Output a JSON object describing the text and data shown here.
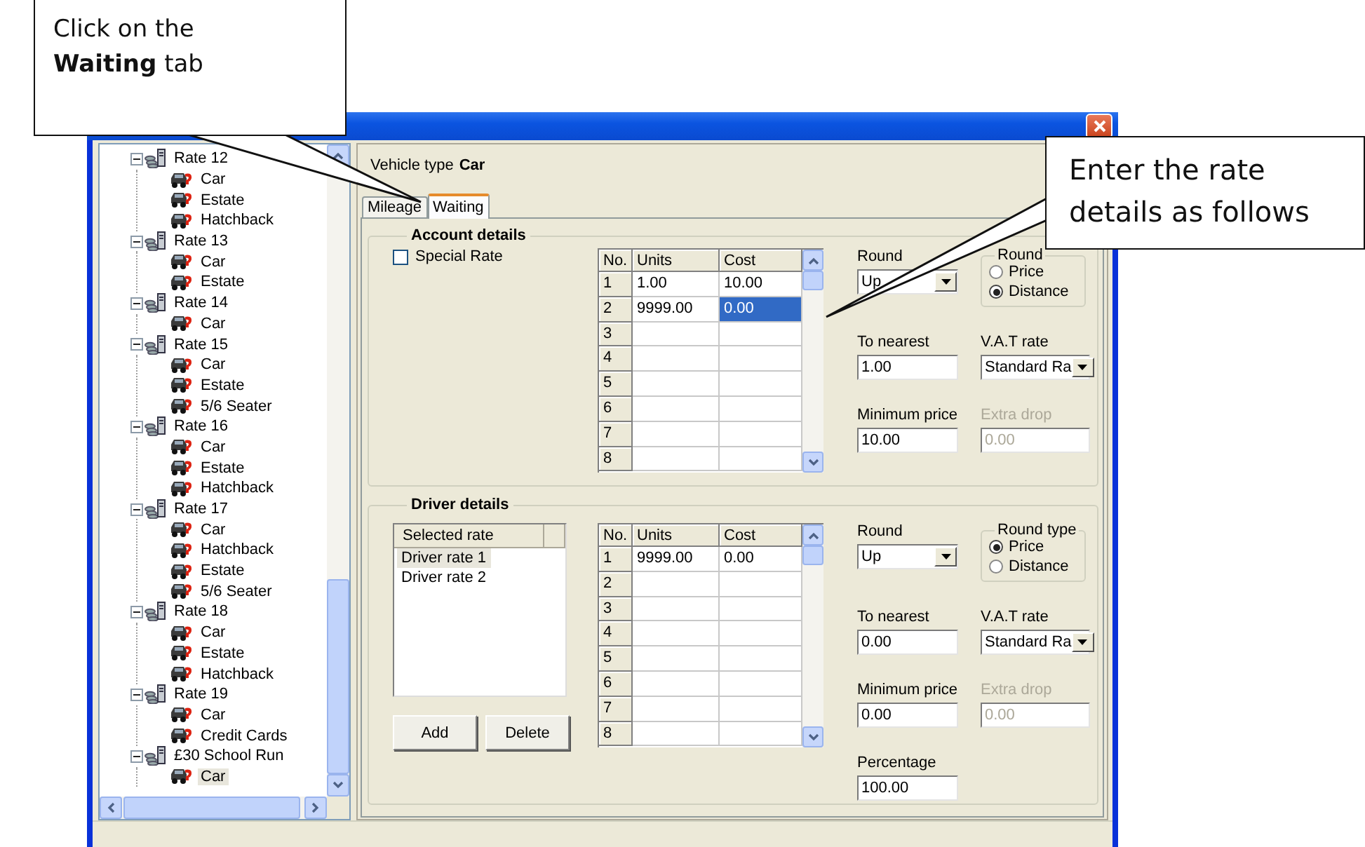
{
  "callouts": [
    {
      "text": "Click on the **Waiting** tab"
    },
    {
      "text": "Enter the rate details as follows"
    }
  ],
  "tree": {
    "items": [
      {
        "label": "Rate 12",
        "expanded": true,
        "selected": false,
        "children": [
          {
            "label": "Car",
            "selected": false
          },
          {
            "label": "Estate",
            "selected": false
          },
          {
            "label": "Hatchback",
            "selected": false
          }
        ]
      },
      {
        "label": "Rate 13",
        "expanded": true,
        "selected": false,
        "children": [
          {
            "label": "Car",
            "selected": false
          },
          {
            "label": "Estate",
            "selected": false
          }
        ]
      },
      {
        "label": "Rate 14",
        "expanded": true,
        "selected": false,
        "children": [
          {
            "label": "Car",
            "selected": false
          }
        ]
      },
      {
        "label": "Rate 15",
        "expanded": true,
        "selected": false,
        "children": [
          {
            "label": "Car",
            "selected": false
          },
          {
            "label": "Estate",
            "selected": false
          },
          {
            "label": "5/6 Seater",
            "selected": false
          }
        ]
      },
      {
        "label": "Rate 16",
        "expanded": true,
        "selected": false,
        "children": [
          {
            "label": "Car",
            "selected": false
          },
          {
            "label": "Estate",
            "selected": false
          },
          {
            "label": "Hatchback",
            "selected": false
          }
        ]
      },
      {
        "label": "Rate 17",
        "expanded": true,
        "selected": false,
        "children": [
          {
            "label": "Car",
            "selected": false
          },
          {
            "label": "Hatchback",
            "selected": false
          },
          {
            "label": "Estate",
            "selected": false
          },
          {
            "label": "5/6 Seater",
            "selected": false
          }
        ]
      },
      {
        "label": "Rate 18",
        "expanded": true,
        "selected": false,
        "children": [
          {
            "label": "Car",
            "selected": false
          },
          {
            "label": "Estate",
            "selected": false
          },
          {
            "label": "Hatchback",
            "selected": false
          }
        ]
      },
      {
        "label": "Rate 19",
        "expanded": true,
        "selected": false,
        "children": [
          {
            "label": "Car",
            "selected": false
          },
          {
            "label": "Credit Cards",
            "selected": false
          }
        ]
      },
      {
        "label": "£30 School Run",
        "expanded": true,
        "selected": false,
        "children": [
          {
            "label": "Car",
            "selected": true
          }
        ]
      }
    ]
  },
  "vehicle_type": {
    "label": "Vehicle type",
    "value": "Car"
  },
  "tabs": [
    {
      "label": "Mileage",
      "selected": false
    },
    {
      "label": "Waiting",
      "selected": true
    }
  ],
  "account_details": {
    "title": "Account details",
    "special_rate": {
      "label": "Special Rate",
      "checked": false
    },
    "grid": {
      "columns": [
        "No.",
        "Units",
        "Cost"
      ],
      "rows": [
        {
          "no": "1",
          "cells": [
            {
              "text": "1.00",
              "selected": false
            },
            {
              "text": "10.00",
              "selected": false
            }
          ]
        },
        {
          "no": "2",
          "cells": [
            {
              "text": "9999.00",
              "selected": false
            },
            {
              "text": "0.00",
              "selected": true
            }
          ]
        },
        {
          "no": "3"
        },
        {
          "no": "4"
        },
        {
          "no": "5"
        },
        {
          "no": "6"
        },
        {
          "no": "7"
        },
        {
          "no": "8"
        }
      ]
    },
    "fields": [
      {
        "kind": "dropdown",
        "label": "Round",
        "value": "Up"
      },
      {
        "kind": "radio_group",
        "legend": "Round",
        "options": [
          {
            "label": "Price",
            "selected": false
          },
          {
            "label": "Distance",
            "selected": true
          }
        ]
      },
      {
        "kind": "text",
        "label": "To nearest",
        "value": "1.00",
        "disabled": false
      },
      {
        "kind": "dropdown",
        "label": "V.A.T rate",
        "value": "Standard Ra"
      },
      {
        "kind": "text",
        "label": "Minimum price",
        "value": "10.00",
        "disabled": false
      },
      {
        "kind": "text",
        "label": "Extra drop",
        "value": "0.00",
        "disabled": true
      }
    ]
  },
  "driver_details": {
    "title": "Driver details",
    "selected_rate": {
      "columns": [
        "Selected rate"
      ],
      "items": [
        {
          "label": "Driver rate 1",
          "selected": true
        },
        {
          "label": "Driver rate 2",
          "selected": false
        }
      ]
    },
    "buttons": [
      "Add",
      "Delete"
    ],
    "grid": {
      "columns": [
        "No.",
        "Units",
        "Cost"
      ],
      "rows": [
        {
          "no": "1",
          "cells": [
            {
              "text": "9999.00",
              "selected": false
            },
            {
              "text": "0.00",
              "selected": false
            }
          ]
        },
        {
          "no": "2"
        },
        {
          "no": "3"
        },
        {
          "no": "4"
        },
        {
          "no": "5"
        },
        {
          "no": "6"
        },
        {
          "no": "7"
        },
        {
          "no": "8"
        }
      ]
    },
    "fields": [
      {
        "kind": "dropdown",
        "label": "Round",
        "value": "Up"
      },
      {
        "kind": "radio_group",
        "legend": "Round type",
        "options": [
          {
            "label": "Price",
            "selected": true
          },
          {
            "label": "Distance",
            "selected": false
          }
        ]
      },
      {
        "kind": "text",
        "label": "To nearest",
        "value": "0.00",
        "disabled": false
      },
      {
        "kind": "dropdown",
        "label": "V.A.T rate",
        "value": "Standard Ra"
      },
      {
        "kind": "text",
        "label": "Minimum price",
        "value": "0.00",
        "disabled": false
      },
      {
        "kind": "text",
        "label": "Extra drop",
        "value": "0.00",
        "disabled": true
      },
      {
        "kind": "text",
        "label": "Percentage",
        "value": "100.00",
        "disabled": false
      }
    ]
  }
}
